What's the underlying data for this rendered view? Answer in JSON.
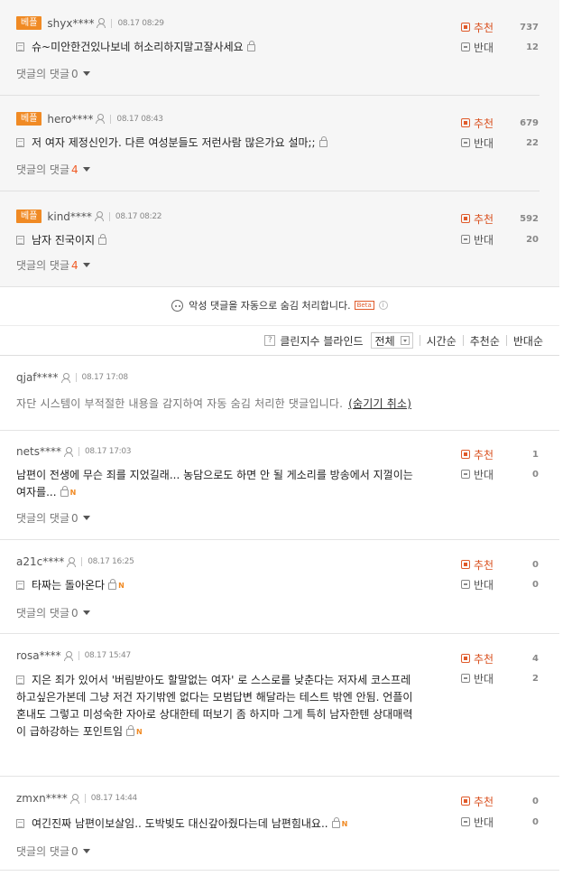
{
  "best_comments": [
    {
      "badge": "베플",
      "nick": "shyx****",
      "date": "08.17 08:29",
      "text": "슈~미안한건있나보네 허소리하지말고잘사세요",
      "reply_label": "댓글의 댓글",
      "reply_count": "0",
      "up_label": "추천",
      "up": "737",
      "down_label": "반대",
      "down": "12"
    },
    {
      "badge": "베플",
      "nick": "hero****",
      "date": "08.17 08:43",
      "text": "저 여자 제정신인가. 다른 여성분들도 저런사람 많은가요 설마;;",
      "reply_label": "댓글의 댓글",
      "reply_count": "4",
      "up_label": "추천",
      "up": "679",
      "down_label": "반대",
      "down": "22"
    },
    {
      "badge": "베플",
      "nick": "kind****",
      "date": "08.17 08:22",
      "text": "남자 진국이지",
      "reply_label": "댓글의 댓글",
      "reply_count": "4",
      "up_label": "추천",
      "up": "592",
      "down_label": "반대",
      "down": "20"
    }
  ],
  "notice": {
    "text": "악성 댓글을 자동으로 숨김 처리합니다.",
    "beta": "Beta",
    "info": "i"
  },
  "sortbar": {
    "help": "?",
    "clean": "클린지수 블라인드",
    "filter": "전체",
    "sorts": [
      "시간순",
      "추천순",
      "반대순"
    ]
  },
  "hidden_comment": {
    "nick": "qjaf****",
    "date": "08.17 17:08",
    "text": "자단 시스템이 부적절한 내용을 감지하여 자동 숨김 처리한 댓글입니다.",
    "unhide": "(숨기기 취소)"
  },
  "comments": [
    {
      "nick": "nets****",
      "date": "08.17 17:03",
      "lines": [
        "남편이 전생에 무슨 죄를 지었길래... 농담으로도 하면 안 될 게소리를 방송에서 지껄이는",
        "여자를..."
      ],
      "reply_label": "댓글의 댓글",
      "reply_count": "0",
      "up_label": "추천",
      "up": "1",
      "down_label": "반대",
      "down": "0"
    },
    {
      "nick": "a21c****",
      "date": "08.17 16:25",
      "lines": [
        "타짜는 돌아온다"
      ],
      "reply_label": "댓글의 댓글",
      "reply_count": "0",
      "up_label": "추천",
      "up": "0",
      "down_label": "반대",
      "down": "0"
    },
    {
      "nick": "rosa****",
      "date": "08.17 15:47",
      "lines": [
        "지은 죄가 있어서 '버림받아도 할말없는 여자' 로 스스로를 낮춘다는 저자세 코스프레",
        "하고싶은가본데 그냥 저건 자기밖엔 없다는 모범답변 해달라는 테스트 밖엔 안됨. 언플이",
        "혼내도 그렇고 미성숙한 자아로 상대한테 떠보기 좀 하지마 그게 특히 남자한텐 상대매력",
        "이 급하강하는 포인트임"
      ],
      "reply_label": "",
      "reply_count": "",
      "up_label": "추천",
      "up": "4",
      "down_label": "반대",
      "down": "2"
    },
    {
      "nick": "zmxn****",
      "date": "08.17 14:44",
      "lines": [
        "여긴진짜 남편이보살임.. 도박빚도 대신갚아줬다는데 남편힘내요.."
      ],
      "reply_label": "댓글의 댓글",
      "reply_count": "0",
      "up_label": "추천",
      "up": "0",
      "down_label": "반대",
      "down": "0"
    }
  ]
}
